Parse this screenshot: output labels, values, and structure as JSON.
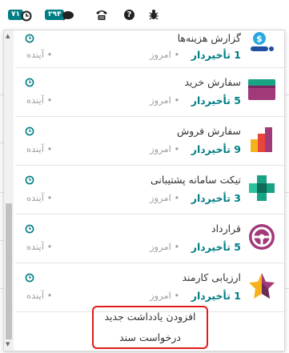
{
  "toolbar": {
    "timer_badge": "۷۱",
    "messages_badge": "۲۹۴",
    "help_label": "?",
    "colors": {
      "badge": "#017e84"
    }
  },
  "activities": [
    {
      "app": "گزارش هزینه‌ها",
      "overdue": "1 تأخیردار",
      "today": "امروز",
      "future": "آینده",
      "icon": "expenses-icon"
    },
    {
      "app": "سفارش خرید",
      "overdue": "5 تأخیردار",
      "today": "امروز",
      "future": "آینده",
      "icon": "purchase-icon"
    },
    {
      "app": "سفارش فروش",
      "overdue": "9 تأخیردار",
      "today": "امروز",
      "future": "آینده",
      "icon": "sales-icon"
    },
    {
      "app": "تیکت سامانه پشتیبانی",
      "overdue": "3 تأخیردار",
      "today": "امروز",
      "future": "آینده",
      "icon": "helpdesk-icon"
    },
    {
      "app": "قرارداد",
      "overdue": "5 تأخیردار",
      "today": "امروز",
      "future": "آینده",
      "icon": "contract-icon"
    },
    {
      "app": "ارزیابی کارمند",
      "overdue": "1 تأخیردار",
      "today": "امروز",
      "future": "آینده",
      "icon": "appraisal-icon"
    }
  ],
  "footer": {
    "add_note": "افزودن یادداشت جدید",
    "request_document": "درخواست سند"
  }
}
